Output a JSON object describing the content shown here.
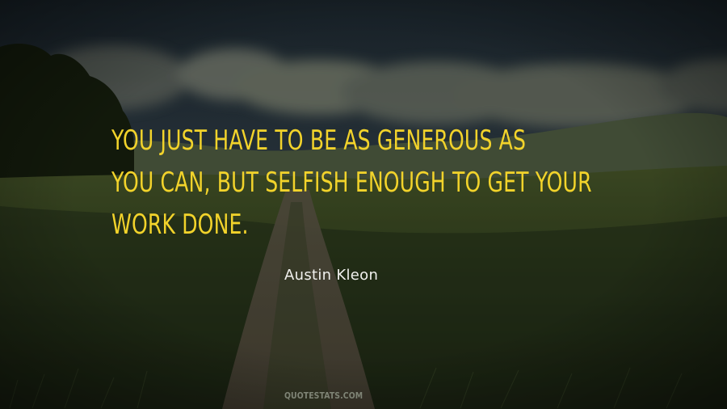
{
  "quote": {
    "lines": [
      "YOU JUST HAVE TO BE AS GENEROUS AS",
      "YOU CAN, BUT SELFISH ENOUGH TO GET YOUR",
      "WORK DONE."
    ]
  },
  "author": "Austin Kleon",
  "watermark": "QUOTESTATS.COM",
  "colors": {
    "quote_text": "#f2d32b",
    "author_text": "#f1f1ee",
    "watermark_text": "#7f8476",
    "sky": "#2b3842",
    "cloud": "#8a8f80",
    "field": "#3c4a22",
    "path": "#6f6653",
    "tree": "#1c2417"
  }
}
